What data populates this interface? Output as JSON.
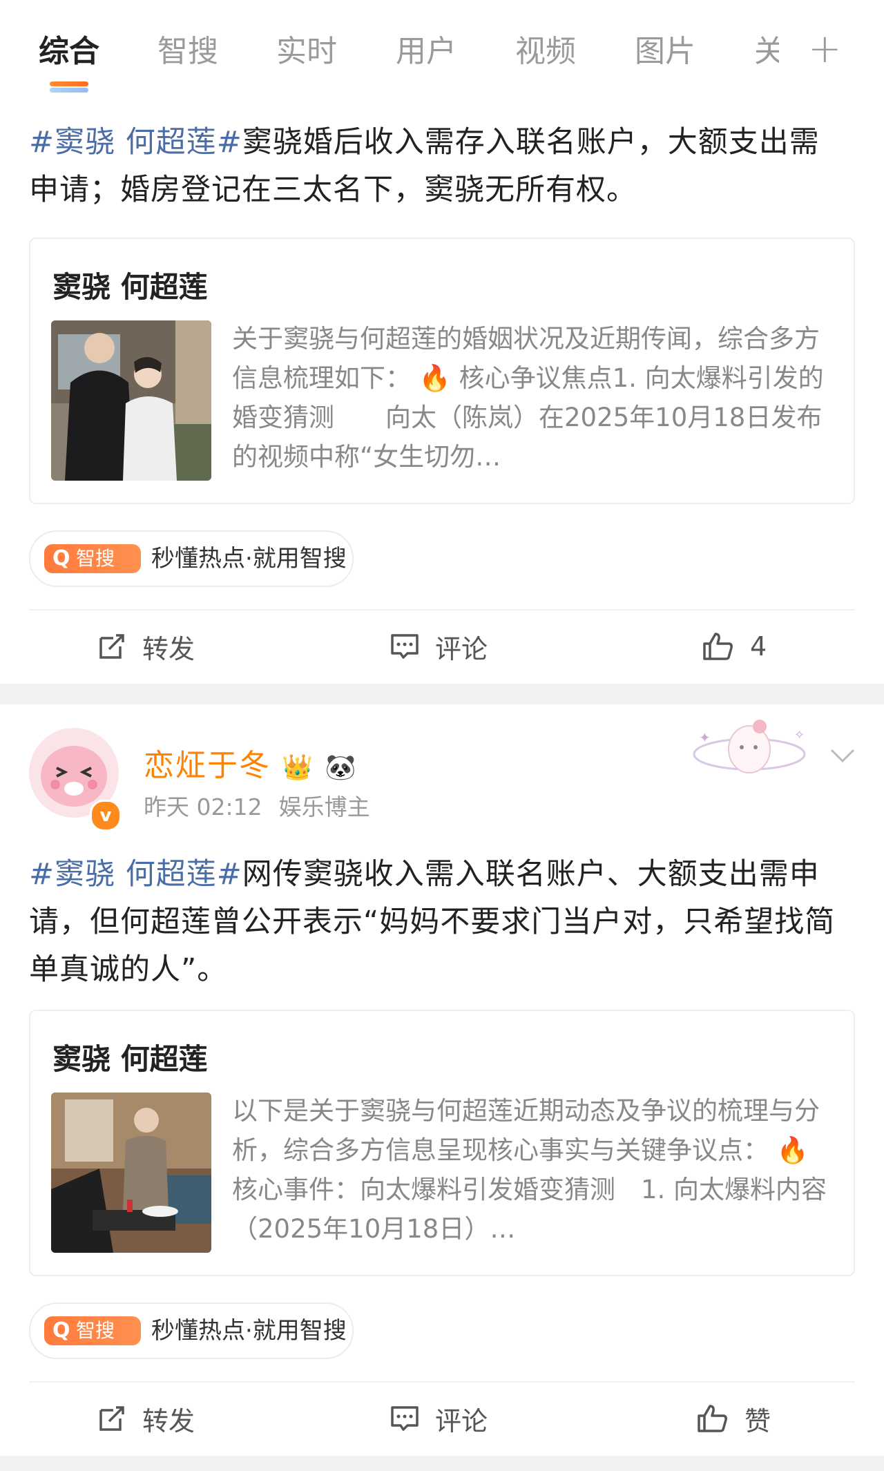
{
  "tabs": [
    "综合",
    "智搜",
    "实时",
    "用户",
    "视频",
    "图片",
    "关"
  ],
  "tabs_more_icon": "plus-icon",
  "posts": [
    {
      "hashtag": "#窦骁 何超莲#",
      "text": "窦骁婚后收入需存入联名账户，大额支出需申请；婚房登记在三太名下，窦骁无所有权。",
      "card": {
        "title": "窦骁 何超莲",
        "summary_a": "关于窦骁与何超莲的婚姻状况及近期传闻，综合多方信息梳理如下：",
        "summary_b": "核心争议焦点1. 向太爆料引发的婚变猜测　　向太（陈岚）在2025年10月18日发布的视频中称“女生切勿…"
      },
      "ai": {
        "badge": "智搜",
        "text": "秒懂热点·就用智搜"
      },
      "actions": {
        "repost": "转发",
        "comment": "评论",
        "like": "4"
      }
    },
    {
      "author": "恋炡于冬",
      "time": "昨天 02:12",
      "tag": "娱乐博主",
      "hashtag": "#窦骁 何超莲#",
      "text": "网传窦骁收入需入联名账户、大额支出需申请，但何超莲曾公开表示“妈妈不要求门当户对，只希望找简单真诚的人”。",
      "card": {
        "title": "窦骁 何超莲",
        "summary_a": "以下是关于窦骁与何超莲近期动态及争议的梳理与分析，综合多方信息呈现核心事实与关键争议点：",
        "summary_b": "核心事件：向太爆料引发婚变猜测　1. 向太爆料内容（2025年10月18日）…"
      },
      "ai": {
        "badge": "智搜",
        "text": "秒懂热点·就用智搜"
      },
      "actions": {
        "repost": "转发",
        "comment": "评论",
        "like": "赞"
      }
    }
  ],
  "colors": {
    "accent": "#ff8200",
    "hashtag": "#4b6da6",
    "ai_badge": "#ff7a3d"
  }
}
